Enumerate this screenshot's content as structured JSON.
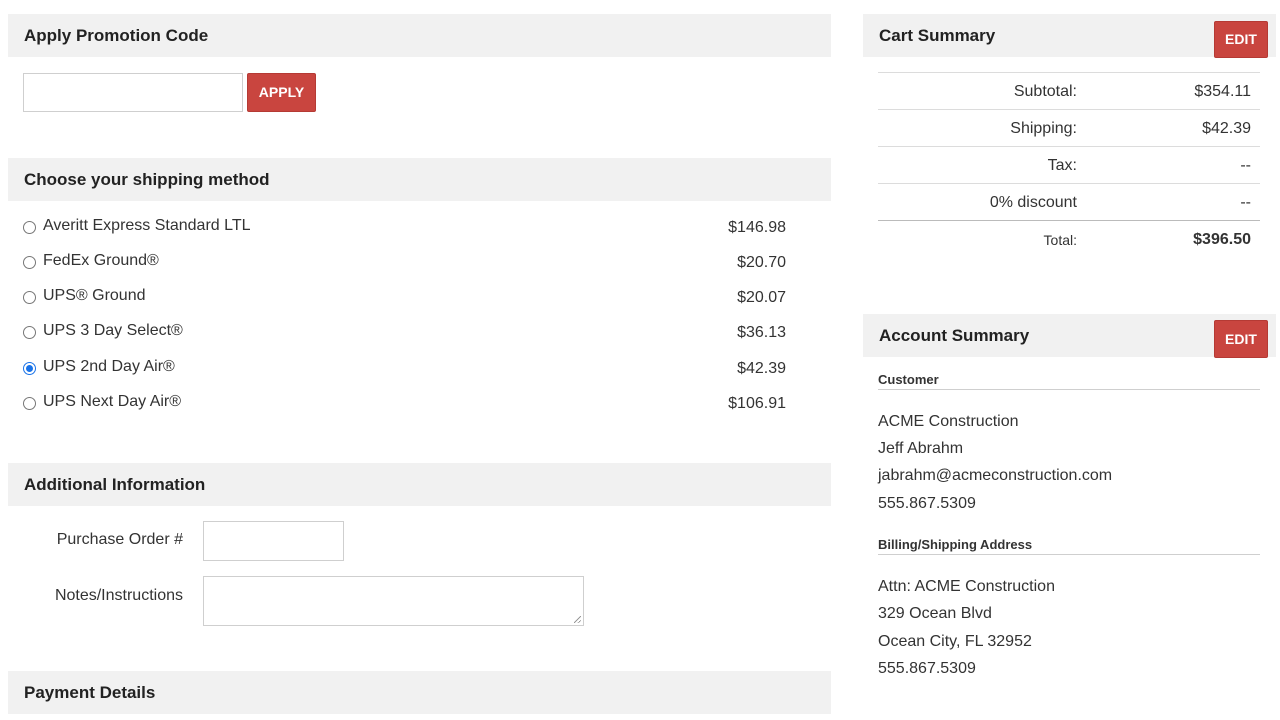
{
  "promo": {
    "header": "Apply Promotion Code",
    "input_value": "",
    "apply_label": "APPLY"
  },
  "shipping": {
    "header": "Choose your shipping method",
    "options": [
      {
        "name": "Averitt Express Standard LTL",
        "price": "$146.98",
        "selected": false
      },
      {
        "name": "FedEx Ground®",
        "price": "$20.70",
        "selected": false
      },
      {
        "name": "UPS® Ground",
        "price": "$20.07",
        "selected": false
      },
      {
        "name": "UPS 3 Day Select®",
        "price": "$36.13",
        "selected": false
      },
      {
        "name": "UPS 2nd Day Air®",
        "price": "$42.39",
        "selected": true
      },
      {
        "name": "UPS Next Day Air®",
        "price": "$106.91",
        "selected": false
      }
    ]
  },
  "additional": {
    "header": "Additional Information",
    "po_label": "Purchase Order #",
    "notes_label": "Notes/Instructions"
  },
  "payment": {
    "header": "Payment Details"
  },
  "cart": {
    "header": "Cart Summary",
    "edit_label": "EDIT",
    "rows": [
      {
        "label": "Subtotal:",
        "value": "$354.11"
      },
      {
        "label": "Shipping:",
        "value": "$42.39"
      },
      {
        "label": "Tax:",
        "value": "--"
      },
      {
        "label": "0% discount",
        "value": "--"
      }
    ],
    "total_label": "Total:",
    "total_value": "$396.50"
  },
  "account": {
    "header": "Account Summary",
    "edit_label": "EDIT",
    "customer_heading": "Customer",
    "customer": [
      "ACME Construction",
      "Jeff Abrahm",
      "jabrahm@acmeconstruction.com",
      "555.867.5309"
    ],
    "address_heading": "Billing/Shipping Address",
    "address": [
      "Attn: ACME Construction",
      "329 Ocean Blvd",
      "Ocean City, FL 32952",
      "555.867.5309"
    ]
  },
  "colors": {
    "accent_red": "#c9453f",
    "header_bg": "#f1f1f1",
    "radio_selected": "#1a73e8"
  }
}
